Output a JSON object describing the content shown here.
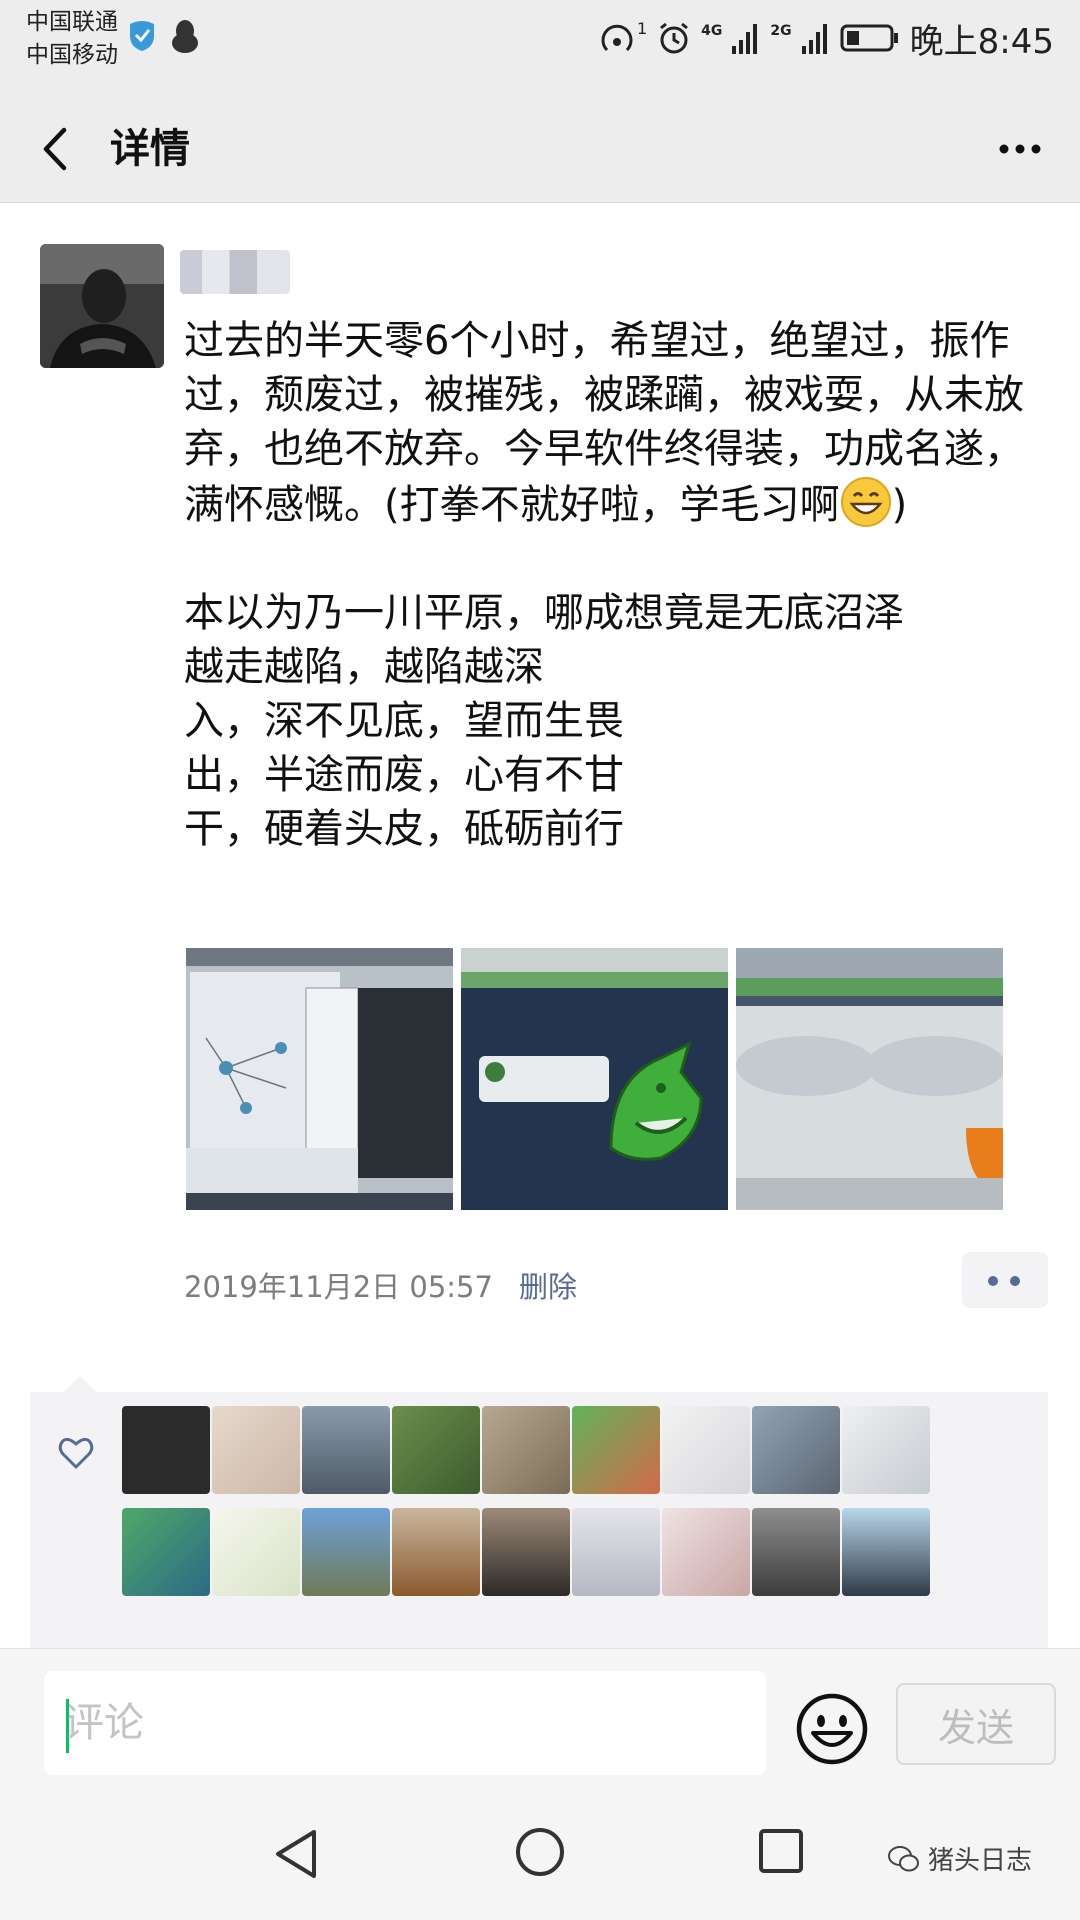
{
  "status_bar": {
    "carrier_1": "中国联通",
    "carrier_2": "中国移动",
    "network_1": "4G",
    "network_2": "2G",
    "hotspot_badge": "1",
    "time": "晚上8:45"
  },
  "header": {
    "title": "详情"
  },
  "post": {
    "text_part1": "过去的半天零6个小时，希望过，绝望过，振作过，颓废过，被摧残，被蹂躏，被戏耍，从未放弃，也绝不放弃。今早软件终得装，功成名遂，满怀感慨。(打拳不就好啦，学毛习啊",
    "text_part2": ")\n\n本以为乃一川平原，哪成想竟是无底沼泽\n越走越陷，越陷越深\n入，深不见底，望而生畏\n出，半途而废，心有不甘\n干，硬着头皮，砥砺前行",
    "timestamp": "2019年11月2日 05:57",
    "delete_label": "删除"
  },
  "comment_bar": {
    "placeholder": "评论",
    "send_label": "发送"
  },
  "watermark": "猪头日志",
  "colors": {
    "link": "#576b95",
    "accent": "#07c160",
    "bar_bg": "#ededed"
  }
}
